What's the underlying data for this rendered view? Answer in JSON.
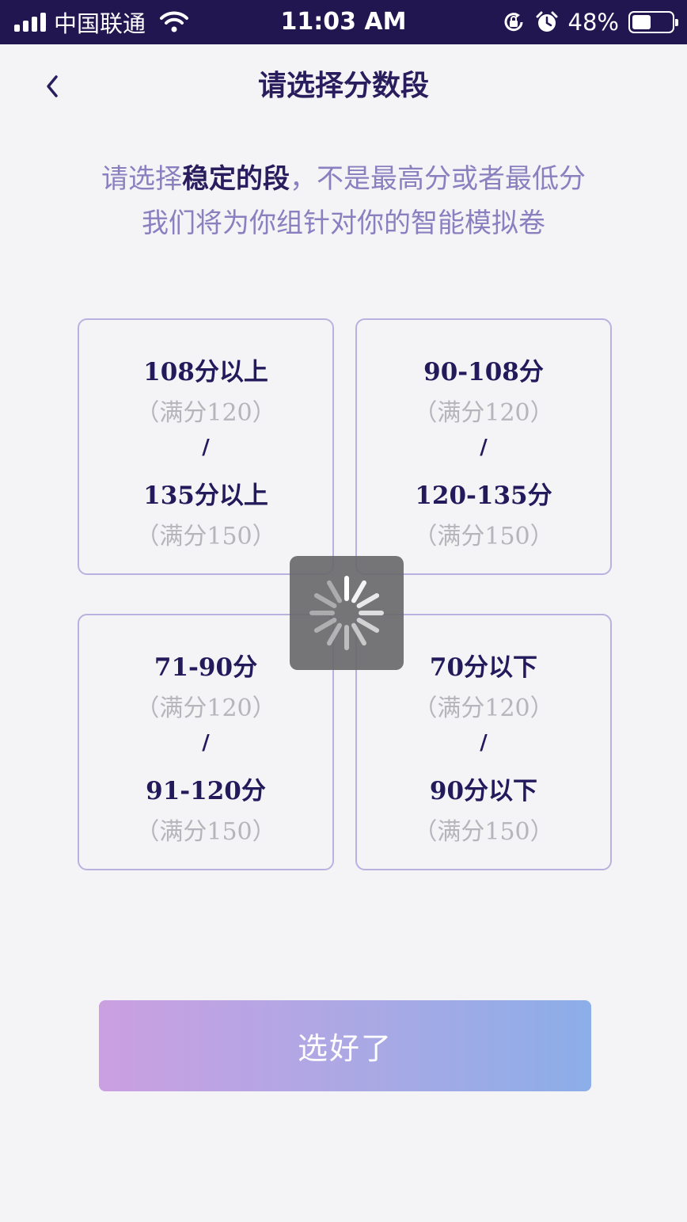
{
  "status_bar": {
    "carrier": "中国联通",
    "time": "11:03 AM",
    "battery": "48%",
    "battery_level": 0.48
  },
  "nav": {
    "title": "请选择分数段"
  },
  "subtitle": {
    "line1_prefix": "请选择",
    "line1_emphasis": "稳定的段",
    "line1_suffix": "，不是最高分或者最低分",
    "line2": "我们将为你组针对你的智能模拟卷"
  },
  "cards": [
    {
      "score_120": "108分以上",
      "full_120": "（满分120）",
      "separator": "/",
      "score_150": "135分以上",
      "full_150": "（满分150）"
    },
    {
      "score_120": "90-108分",
      "full_120": "（满分120）",
      "separator": "/",
      "score_150": "120-135分",
      "full_150": "（满分150）"
    },
    {
      "score_120": "71-90分",
      "full_120": "（满分120）",
      "separator": "/",
      "score_150": "91-120分",
      "full_150": "（满分150）"
    },
    {
      "score_120": "70分以下",
      "full_120": "（满分120）",
      "separator": "/",
      "score_150": "90分以下",
      "full_150": "（满分150）"
    }
  ],
  "confirm_button": {
    "label": "选好了"
  },
  "icons": {
    "back": "chevron-left-icon",
    "wifi": "wifi-icon",
    "orientation_lock": "orientation-lock-icon",
    "alarm": "alarm-icon",
    "spinner": "loading-spinner-icon"
  },
  "colors": {
    "status_bar_bg": "#221650",
    "title": "#2a1d5e",
    "accent_text": "#8a80c0",
    "card_border": "#b9b1e0",
    "button_gradient_start": "#c99be0",
    "button_gradient_end": "#86aae8"
  }
}
